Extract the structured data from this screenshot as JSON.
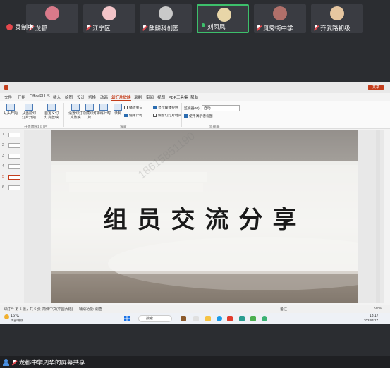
{
  "recording": {
    "label": "录制中"
  },
  "participants": [
    {
      "name": "龙都...",
      "muted": true,
      "active": false,
      "avatar_color": "#d97a8a"
    },
    {
      "name": "江宁区...",
      "muted": true,
      "active": false,
      "avatar_color": "#f2c4c8"
    },
    {
      "name": "麒麟科创园...",
      "muted": true,
      "active": false,
      "avatar_color": "#c9c9c9"
    },
    {
      "name": "刘凤凤",
      "muted": false,
      "active": true,
      "avatar_color": "#e8d6a8"
    },
    {
      "name": "觅秀街中学...",
      "muted": true,
      "active": false,
      "avatar_color": "#b0706a"
    },
    {
      "name": "齐武路初级...",
      "muted": true,
      "active": false,
      "avatar_color": "#e6c6a0"
    }
  ],
  "ppt": {
    "menu": [
      "文件",
      "开始",
      "OfficePLUS",
      "插入",
      "绘图",
      "设计",
      "切换",
      "动画",
      "幻灯片放映",
      "录制",
      "审阅",
      "视图",
      "PDF工具集",
      "帮助"
    ],
    "selected_menu": "幻灯片放映",
    "share_button": "共享",
    "ribbon": {
      "start_group": {
        "buttons": [
          "从头开始",
          "从当前幻灯片开始",
          "自定义幻灯片放映"
        ],
        "label": "开始放映幻灯片"
      },
      "setup_group": {
        "buttons": [
          "设置幻灯片放映",
          "隐藏幻灯片",
          "排练计时",
          "录制"
        ],
        "checks": [
          {
            "label": "播放旁白",
            "checked": false
          },
          {
            "label": "使用计时",
            "checked": true
          },
          {
            "label": "显示媒体控件",
            "checked": true
          },
          {
            "label": "保留幻灯片时间",
            "checked": false
          }
        ],
        "label": "设置"
      },
      "monitor_group": {
        "monitor_label": "监视器(M):",
        "monitor_value": "自动",
        "presenter_view": "使用演示者视图",
        "label": "监视器"
      }
    },
    "slides": [
      {
        "num": "1"
      },
      {
        "num": "2"
      },
      {
        "num": "3"
      },
      {
        "num": "4"
      },
      {
        "num": "5",
        "selected": true
      },
      {
        "num": "6"
      }
    ],
    "slide_title": "组员交流分享",
    "status": {
      "slide_info": "幻灯片 第 5 张，共 6 张",
      "language": "简体中文(中国大陆)",
      "accessibility": "辅助功能: 调查",
      "notes": "备注",
      "zoom": "92%"
    },
    "watermark": "18615851190"
  },
  "taskbar": {
    "weather_temp": "16°C",
    "weather_desc": "大部晴朗",
    "search_placeholder": "搜索",
    "time": "13:17",
    "date": "2024/4/17"
  },
  "share_bar": {
    "label": "龙都中学周华的屏幕共享"
  }
}
